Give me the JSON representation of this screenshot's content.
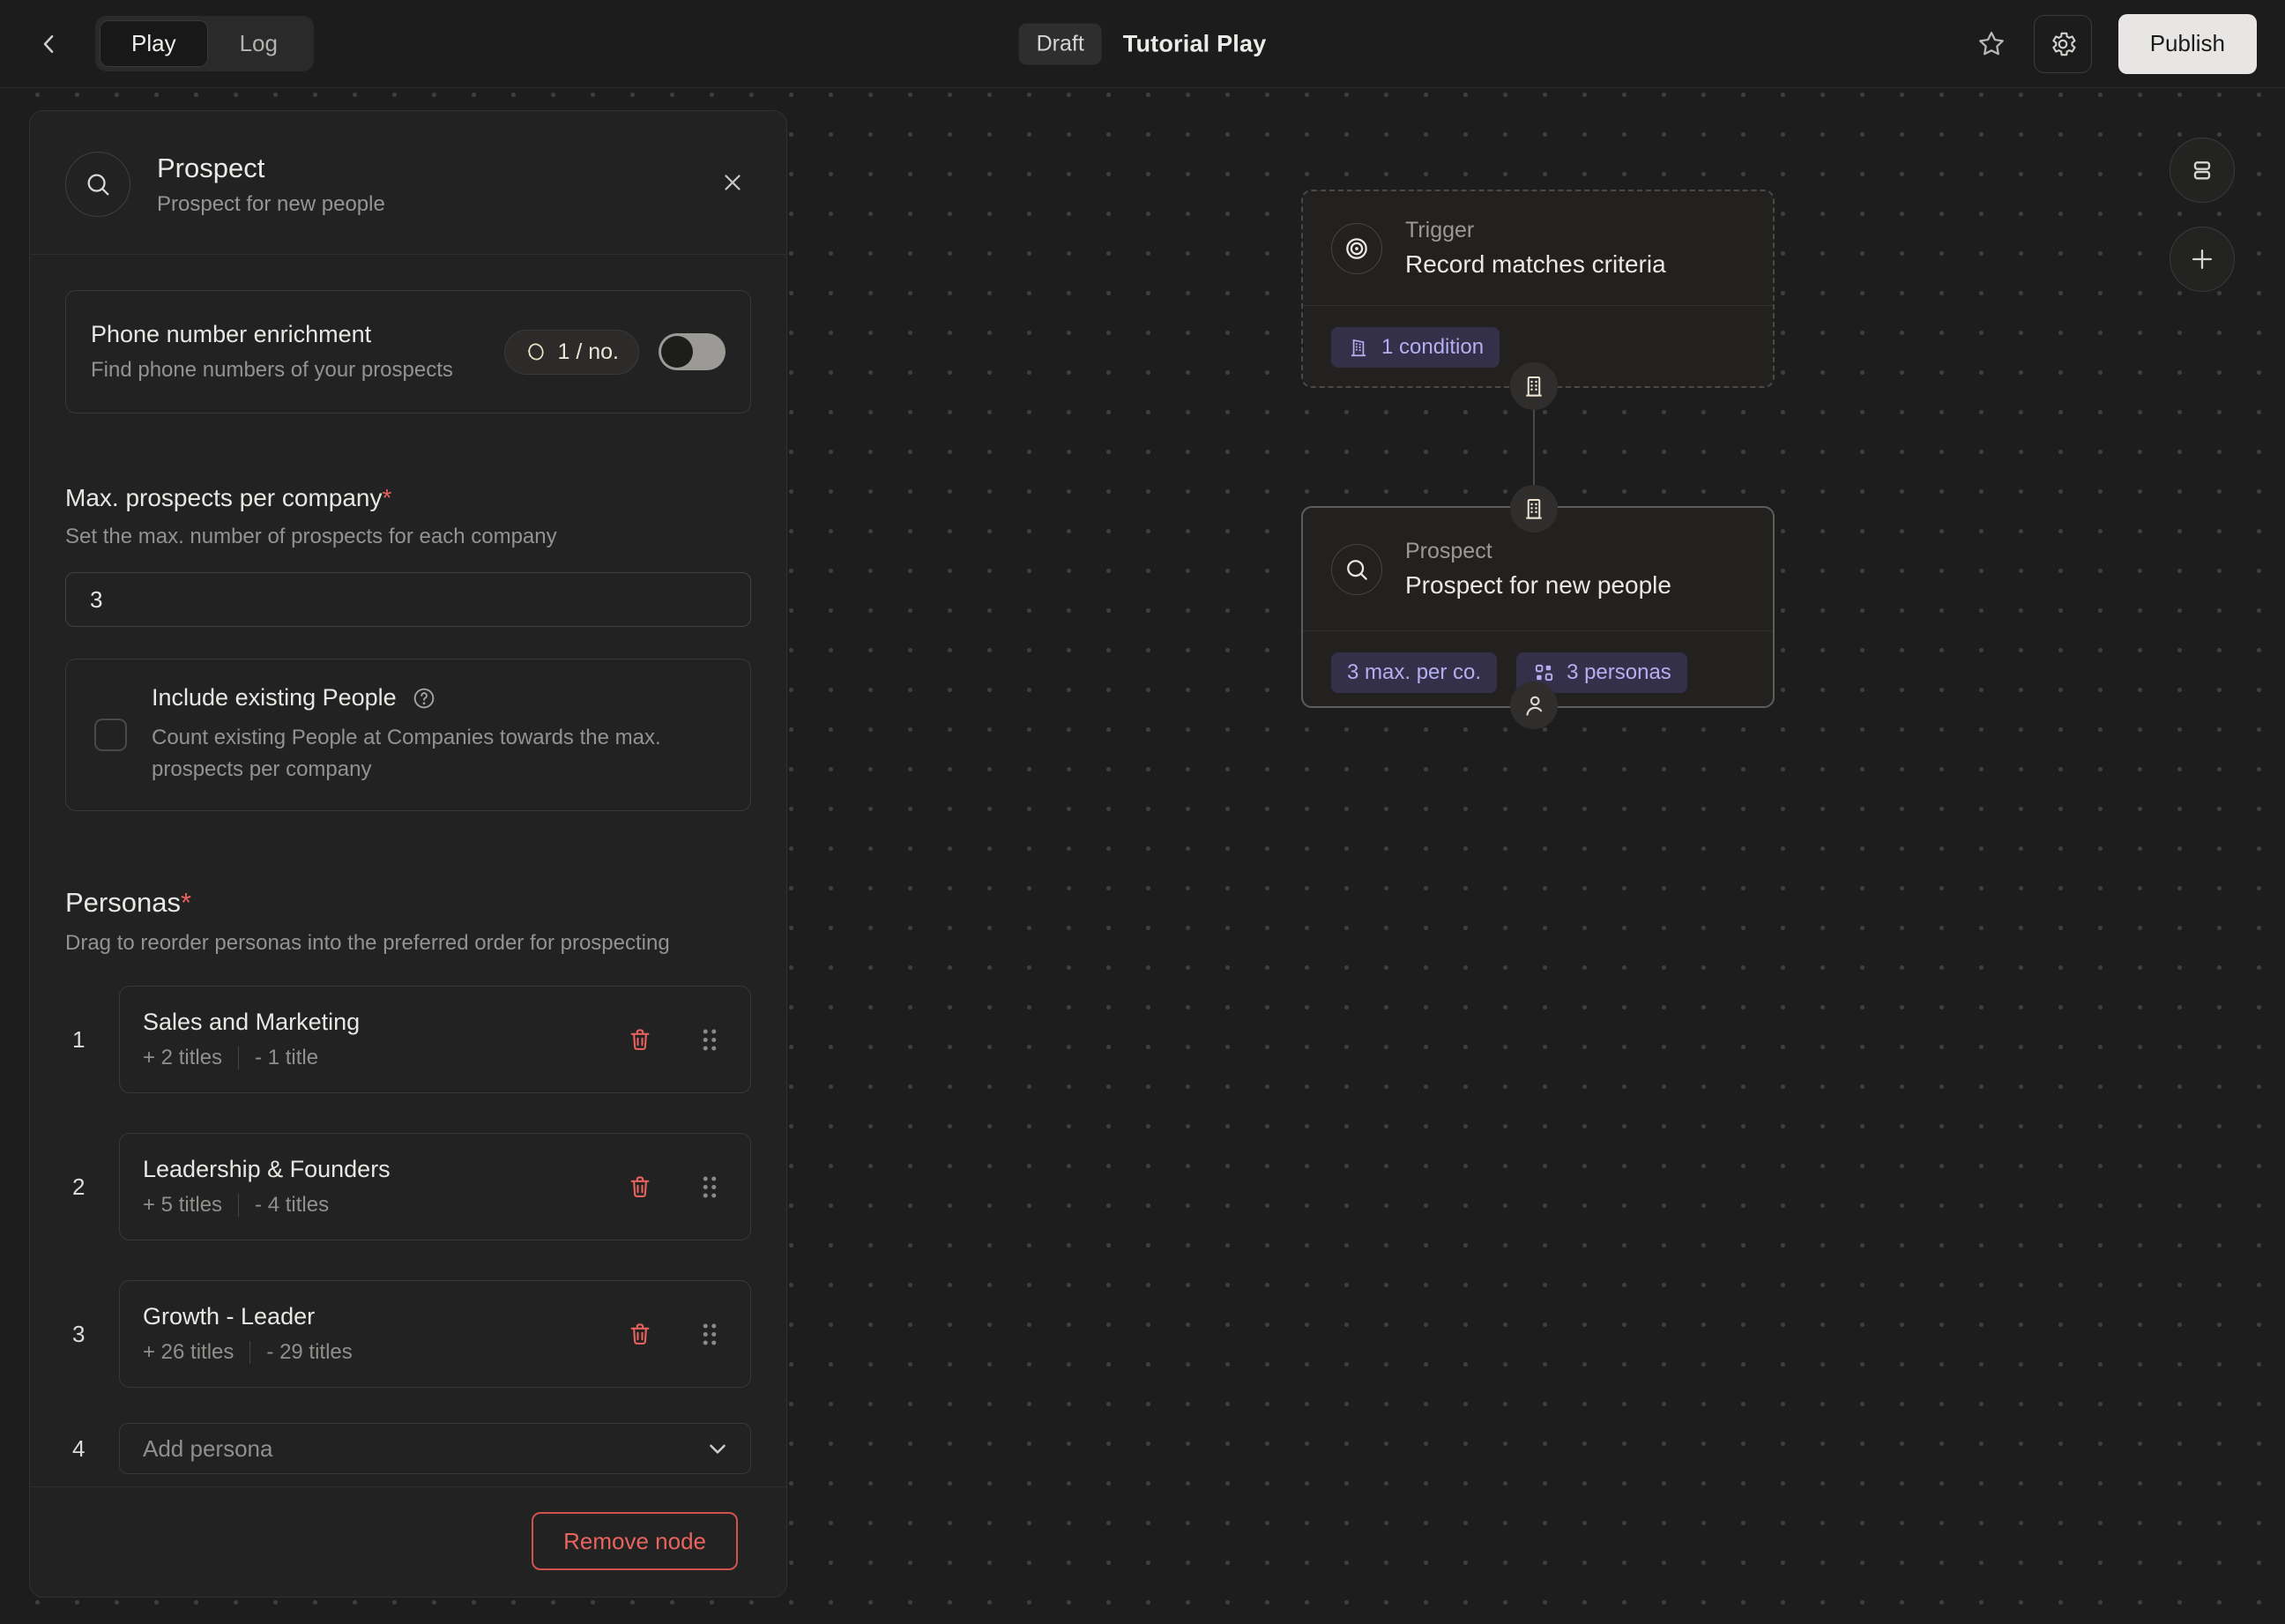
{
  "topbar": {
    "tabs": {
      "play": "Play",
      "log": "Log"
    },
    "status_badge": "Draft",
    "title": "Tutorial Play",
    "publish_label": "Publish"
  },
  "panel": {
    "title": "Prospect",
    "subtitle": "Prospect for new people",
    "phone": {
      "title": "Phone number enrichment",
      "subtitle": "Find phone numbers of your prospects",
      "credit_badge": "1 / no.",
      "toggle_on": false
    },
    "max_prospects": {
      "label": "Max. prospects per company",
      "required_mark": "*",
      "description": "Set the max. number of prospects for each company",
      "value": "3"
    },
    "include_existing": {
      "label": "Include existing People",
      "description": "Count existing People at Companies towards the max. prospects per company",
      "checked": false
    },
    "personas": {
      "label": "Personas",
      "required_mark": "*",
      "description": "Drag to reorder personas into the preferred order for prospecting",
      "items": [
        {
          "index": "1",
          "name": "Sales and Marketing",
          "added": "+ 2 titles",
          "removed": "- 1 title"
        },
        {
          "index": "2",
          "name": "Leadership & Founders",
          "added": "+ 5 titles",
          "removed": "- 4 titles"
        },
        {
          "index": "3",
          "name": "Growth - Leader",
          "added": "+ 26 titles",
          "removed": "- 29 titles"
        }
      ],
      "add_row": {
        "index": "4",
        "placeholder": "Add persona"
      }
    },
    "remove_node_label": "Remove node"
  },
  "canvas": {
    "trigger_node": {
      "type": "Trigger",
      "title": "Record matches criteria",
      "condition_badge": "1 condition"
    },
    "prospect_node": {
      "type": "Prospect",
      "title": "Prospect for new people",
      "badge_max": "3 max. per co.",
      "badge_personas": "3 personas"
    }
  },
  "colors": {
    "accent_red": "#e5625e",
    "accent_purple_text": "#b5aef0",
    "accent_purple_bg": "#343049",
    "publish_bg": "#e7e6e4",
    "canvas_bg": "#1d1d1d",
    "panel_bg": "#232222"
  }
}
